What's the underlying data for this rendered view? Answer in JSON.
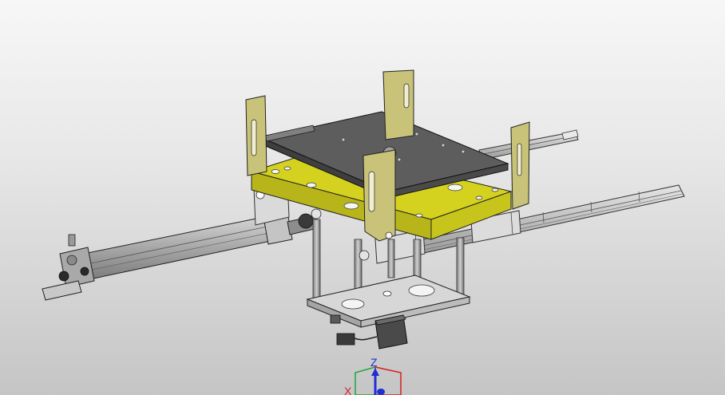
{
  "viewport": {
    "background_top": "#f7f7f7",
    "background_bottom": "#c5c5c5"
  },
  "model": {
    "colors": {
      "plate_yellow": "#d4d21e",
      "bracket_khaki": "#c9c37a",
      "top_plate_dark": "#5d5d5d",
      "rail_gray": "#cfcfcf",
      "cylinder_gray": "#bdbdbd",
      "base_plate": "#d7d7d7"
    }
  },
  "triad": {
    "z_label": "Z",
    "x_label": "X",
    "z_color": "#1f2fd8",
    "x_color": "#d81f1f",
    "y_color": "#1fa83a"
  }
}
